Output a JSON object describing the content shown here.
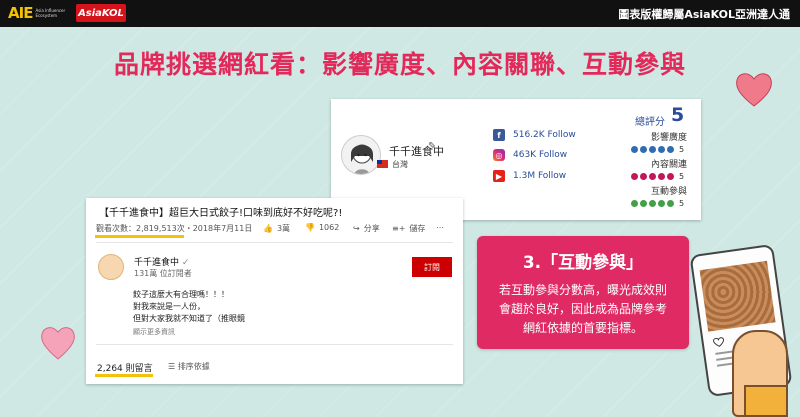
{
  "topbar": {
    "logo_aie": "AIE",
    "logo_aie_sub": "Asia Influencer Ecosystem",
    "logo_kol": "AsiaKOL",
    "right_text": "圖表版權歸屬AsiaKOL亞洲達人通"
  },
  "heading": "品牌挑選網紅看：影響廣度、內容關聯、互動參與",
  "profile": {
    "name": "千千進食中",
    "region": "台灣",
    "social": {
      "facebook": "516.2K Follow",
      "instagram": "463K Follow",
      "youtube": "1.3M Follow"
    },
    "score_label": "總評分",
    "score_value": "5",
    "metrics": [
      {
        "label": "影響廣度",
        "value": "5",
        "rating": 5,
        "color": "#2f6db0"
      },
      {
        "label": "內容關連",
        "value": "5",
        "rating": 5,
        "color": "#c2185b"
      },
      {
        "label": "互動參與",
        "value": "5",
        "rating": 5,
        "color": "#43a047"
      }
    ]
  },
  "youtube": {
    "title": "【千千進食中】超巨大日式餃子!口味到底好不好吃呢?!",
    "views": "觀看次數：2,819,513次・2018年7月11日",
    "likes": "3萬",
    "dislikes": "1062",
    "share": "分享",
    "save": "儲存",
    "channel": "千千進食中",
    "subscribers": "131萬 位訂閱者",
    "subscribe_label": "訂閱",
    "desc_line1": "餃子這麼大有合理嗎！！！",
    "desc_line2": "對我來說是一人份，",
    "desc_line3": "但對大家我就不知道了（推眼鏡",
    "show_more": "顯示更多資訊",
    "comments": "2,264 則留言",
    "sort": "排序依據"
  },
  "callout": {
    "title": "3.「互動參與」",
    "line1": "若互動參與分數高，曝光成效則",
    "line2": "會趨於良好，因此成為品牌參考",
    "line3": "網紅依據的首要指標。"
  },
  "colors": {
    "accent_pink": "#df2a64",
    "heading_pink": "#e3285a",
    "background": "#cfe8e4"
  }
}
